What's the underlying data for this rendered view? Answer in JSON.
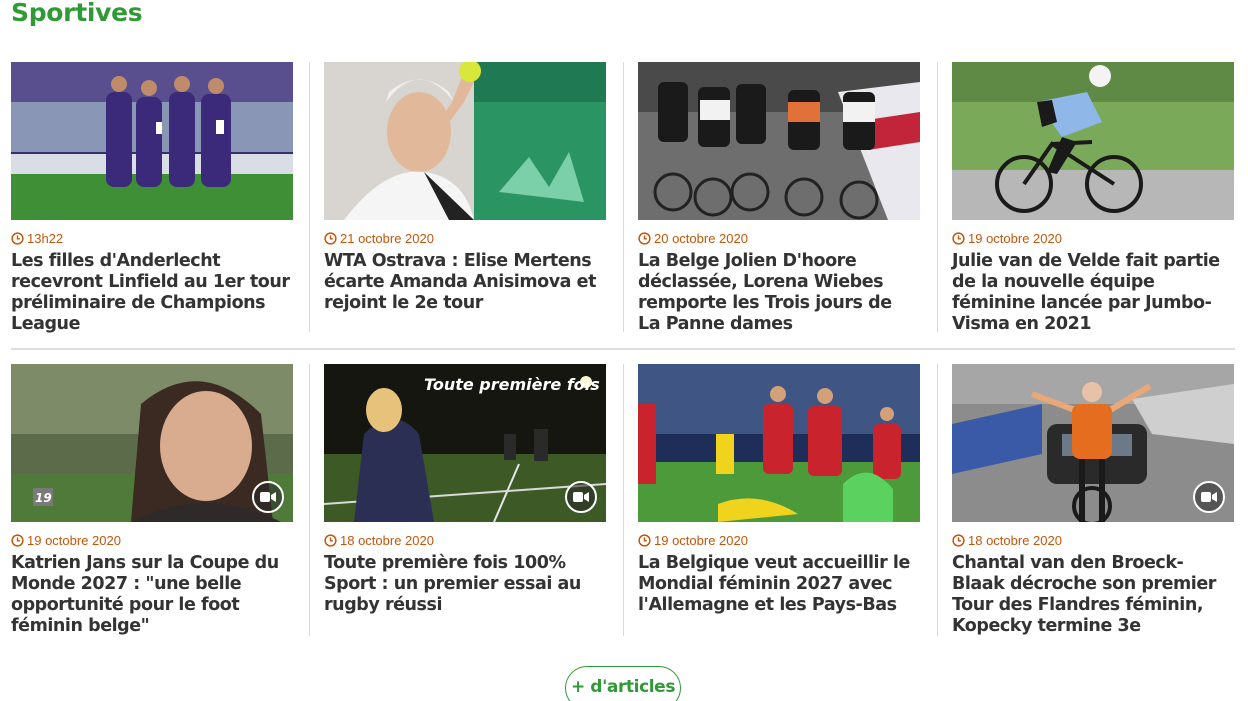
{
  "section": {
    "title": "Sportives"
  },
  "articles": [
    {
      "time": "13h22",
      "title": "Les filles d'Anderlecht recevront Linfield au 1er tour préliminaire de Champions League",
      "video": false
    },
    {
      "time": "21 octobre 2020",
      "title": "WTA Ostrava : Elise Mertens écarte Amanda Anisimova et rejoint le 2e tour",
      "video": false
    },
    {
      "time": "20 octobre 2020",
      "title": "La Belge Jolien D'hoore déclassée, Lorena Wiebes remporte les Trois jours de La Panne dames",
      "video": false
    },
    {
      "time": "19 octobre 2020",
      "title": "Julie van de Velde fait partie de la nouvelle équipe féminine lancée par Jumbo-Visma en 2021",
      "video": false
    },
    {
      "time": "19 octobre 2020",
      "title": "Katrien Jans sur la Coupe du Monde 2027 : \"une belle opportunité pour le foot féminin belge\"",
      "video": true
    },
    {
      "time": "18 octobre 2020",
      "title": "Toute première fois 100% Sport : un premier essai au rugby réussi",
      "video": true
    },
    {
      "time": "19 octobre 2020",
      "title": "La Belgique veut accueillir le Mondial féminin 2027 avec l'Allemagne et les Pays-Bas",
      "video": false
    },
    {
      "time": "18 octobre 2020",
      "title": "Chantal van den Broeck-Blaak décroche son premier Tour des Flandres féminin, Kopecky termine 3e",
      "video": true
    }
  ],
  "image_text": {
    "channel_badge": "19",
    "rugby_logo": "Toute première fois"
  },
  "more_button": {
    "label": "+ d'articles"
  },
  "colors": {
    "accent": "#2f9a36",
    "meta": "#c2570c",
    "text": "#333333"
  },
  "icons": {
    "time": "clock-icon",
    "video": "video-camera-icon"
  }
}
